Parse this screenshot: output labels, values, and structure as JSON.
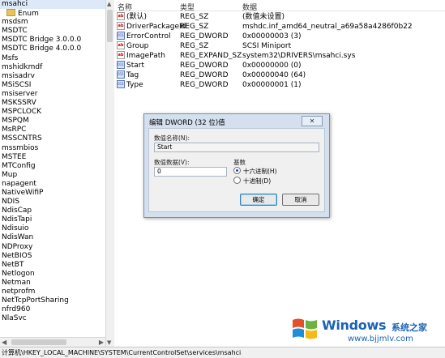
{
  "tree": {
    "items": [
      {
        "label": "msahci",
        "selected": true
      },
      {
        "label": "Enum",
        "folder": true
      },
      {
        "label": "msdsm"
      },
      {
        "label": "MSDTC"
      },
      {
        "label": "MSDTC Bridge 3.0.0.0"
      },
      {
        "label": "MSDTC Bridge 4.0.0.0"
      },
      {
        "label": "Msfs"
      },
      {
        "label": "mshidkmdf"
      },
      {
        "label": "msisadrv"
      },
      {
        "label": "MSiSCSI"
      },
      {
        "label": "msiserver"
      },
      {
        "label": "MSKSSRV"
      },
      {
        "label": "MSPCLOCK"
      },
      {
        "label": "MSPQM"
      },
      {
        "label": "MsRPC"
      },
      {
        "label": "MSSCNTRS"
      },
      {
        "label": "mssmbios"
      },
      {
        "label": "MSTEE"
      },
      {
        "label": "MTConfig"
      },
      {
        "label": "Mup"
      },
      {
        "label": "napagent"
      },
      {
        "label": "NativeWifiP"
      },
      {
        "label": "NDIS"
      },
      {
        "label": "NdisCap"
      },
      {
        "label": "NdisTapi"
      },
      {
        "label": "Ndisuio"
      },
      {
        "label": "NdisWan"
      },
      {
        "label": "NDProxy"
      },
      {
        "label": "NetBIOS"
      },
      {
        "label": "NetBT"
      },
      {
        "label": "Netlogon"
      },
      {
        "label": "Netman"
      },
      {
        "label": "netprofm"
      },
      {
        "label": "NetTcpPortSharing"
      },
      {
        "label": "nfrd960"
      },
      {
        "label": "NlaSvc"
      }
    ]
  },
  "list": {
    "headers": {
      "name": "名称",
      "type": "类型",
      "data": "数据"
    },
    "rows": [
      {
        "icon": "string-value-icon",
        "name": "(默认)",
        "type": "REG_SZ",
        "data": "(数值未设置)"
      },
      {
        "icon": "string-value-icon",
        "name": "DriverPackageId",
        "type": "REG_SZ",
        "data": "mshdc.inf_amd64_neutral_a69a58a4286f0b22"
      },
      {
        "icon": "binary-value-icon",
        "name": "ErrorControl",
        "type": "REG_DWORD",
        "data": "0x00000003 (3)"
      },
      {
        "icon": "string-value-icon",
        "name": "Group",
        "type": "REG_SZ",
        "data": "SCSI Miniport"
      },
      {
        "icon": "string-value-icon",
        "name": "ImagePath",
        "type": "REG_EXPAND_SZ",
        "data": "system32\\DRIVERS\\msahci.sys"
      },
      {
        "icon": "binary-value-icon",
        "name": "Start",
        "type": "REG_DWORD",
        "data": "0x00000000 (0)"
      },
      {
        "icon": "binary-value-icon",
        "name": "Tag",
        "type": "REG_DWORD",
        "data": "0x00000040 (64)"
      },
      {
        "icon": "binary-value-icon",
        "name": "Type",
        "type": "REG_DWORD",
        "data": "0x00000001 (1)"
      }
    ]
  },
  "dialog": {
    "title": "编辑 DWORD (32 位)值",
    "close_label": "✕",
    "value_name_label": "数值名称(N):",
    "value_name": "Start",
    "value_data_label": "数值数据(V):",
    "value_data": "0",
    "base_label": "基数",
    "radio_hex": "十六进制(H)",
    "radio_dec": "十进制(D)",
    "selected_base": "hex",
    "ok_label": "确定",
    "cancel_label": "取消"
  },
  "status_bar": {
    "path": "计算机\\HKEY_LOCAL_MACHINE\\SYSTEM\\CurrentControlSet\\services\\msahci"
  },
  "watermark": {
    "brand": "Windows",
    "brand_cn": "系统之家",
    "url": "www.bjjmlv.com"
  },
  "colors": {
    "dialog_frame": "#d4e0ee",
    "selection": "#dce9f9",
    "watermark_blue": "#1a63b5"
  }
}
